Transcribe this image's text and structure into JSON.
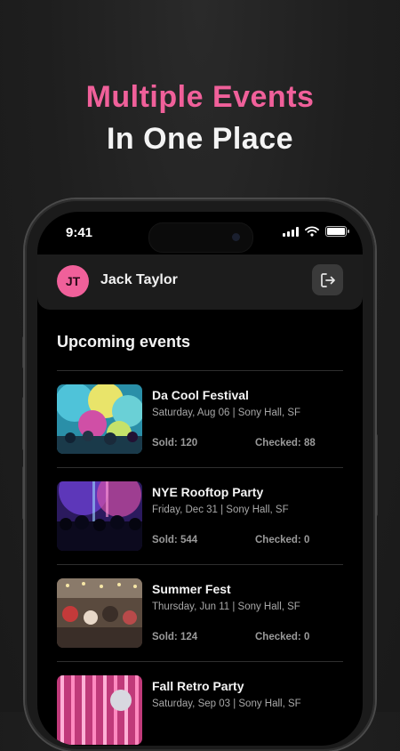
{
  "headline": {
    "line1": "Multiple Events",
    "line2": "In One Place"
  },
  "status_bar": {
    "time": "9:41"
  },
  "user": {
    "initials": "JT",
    "name": "Jack Taylor"
  },
  "section_title": "Upcoming events",
  "events": [
    {
      "name": "Da Cool Festival",
      "date": "Saturday, Aug 06 | Sony Hall, SF",
      "sold": "Sold: 120",
      "checked": "Checked: 88"
    },
    {
      "name": "NYE Rooftop Party",
      "date": "Friday, Dec 31 | Sony Hall, SF",
      "sold": "Sold: 544",
      "checked": "Checked: 0"
    },
    {
      "name": "Summer Fest",
      "date": "Thursday, Jun 11 | Sony Hall, SF",
      "sold": "Sold: 124",
      "checked": "Checked: 0"
    },
    {
      "name": "Fall Retro Party",
      "date": "Saturday, Sep 03 | Sony Hall, SF",
      "sold": "",
      "checked": ""
    }
  ],
  "colors": {
    "accent": "#f0609a",
    "background": "#1e1e1e",
    "screen": "#000000",
    "header_card": "#1c1c1c"
  },
  "icons": {
    "logout": "logout-icon",
    "signal": "cellular-signal-icon",
    "wifi": "wifi-icon",
    "battery": "battery-icon"
  }
}
